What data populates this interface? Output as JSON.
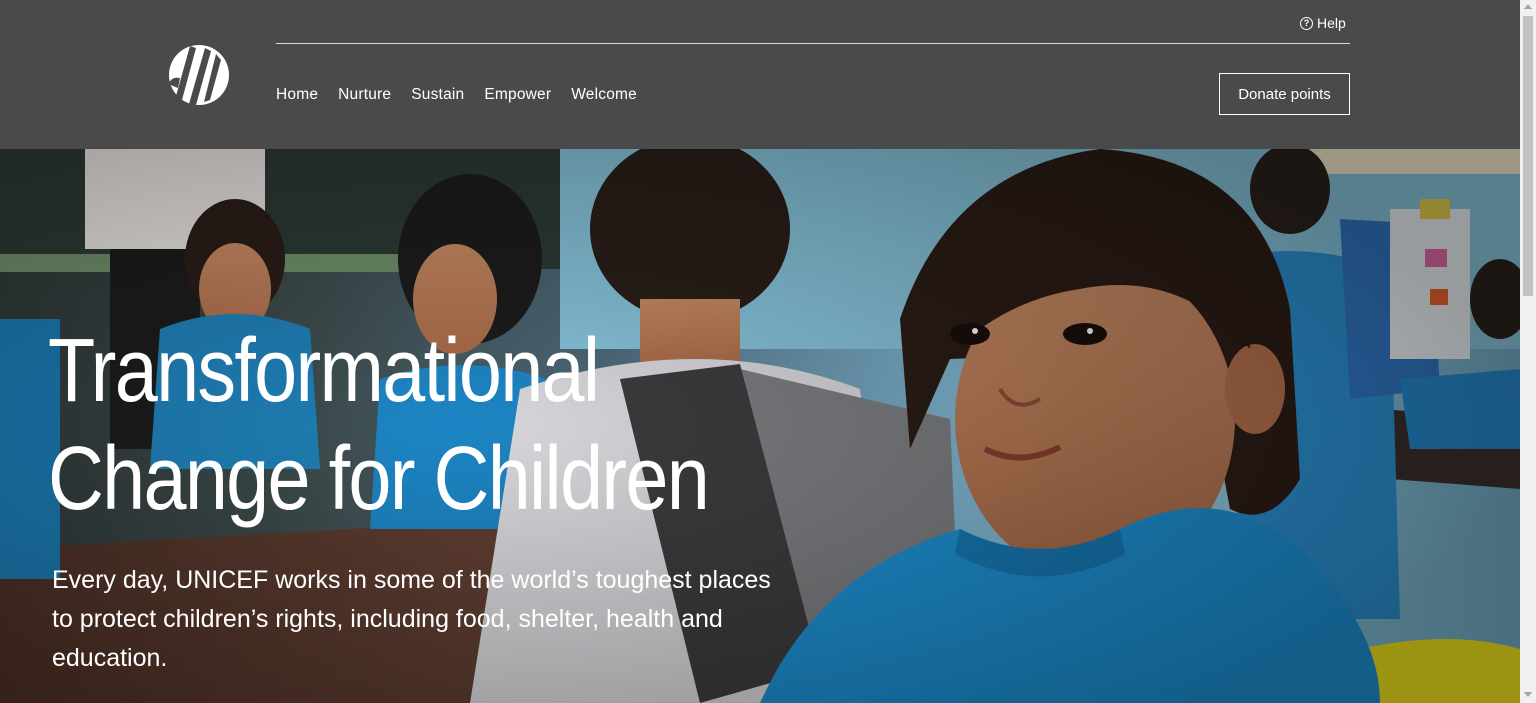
{
  "header": {
    "help_label": "Help",
    "nav": [
      "Home",
      "Nurture",
      "Sustain",
      "Empower",
      "Welcome"
    ],
    "donate_label": "Donate points"
  },
  "hero": {
    "title_line1": "Transformational",
    "title_line2": "Change for Children",
    "subtitle": "Every day, UNICEF works in some of the world’s toughest places to protect children’s rights, including food, shelter, health and education."
  },
  "colors": {
    "header_bg": "#4a4a4a",
    "shirt_blue": "#1d8fd1"
  }
}
